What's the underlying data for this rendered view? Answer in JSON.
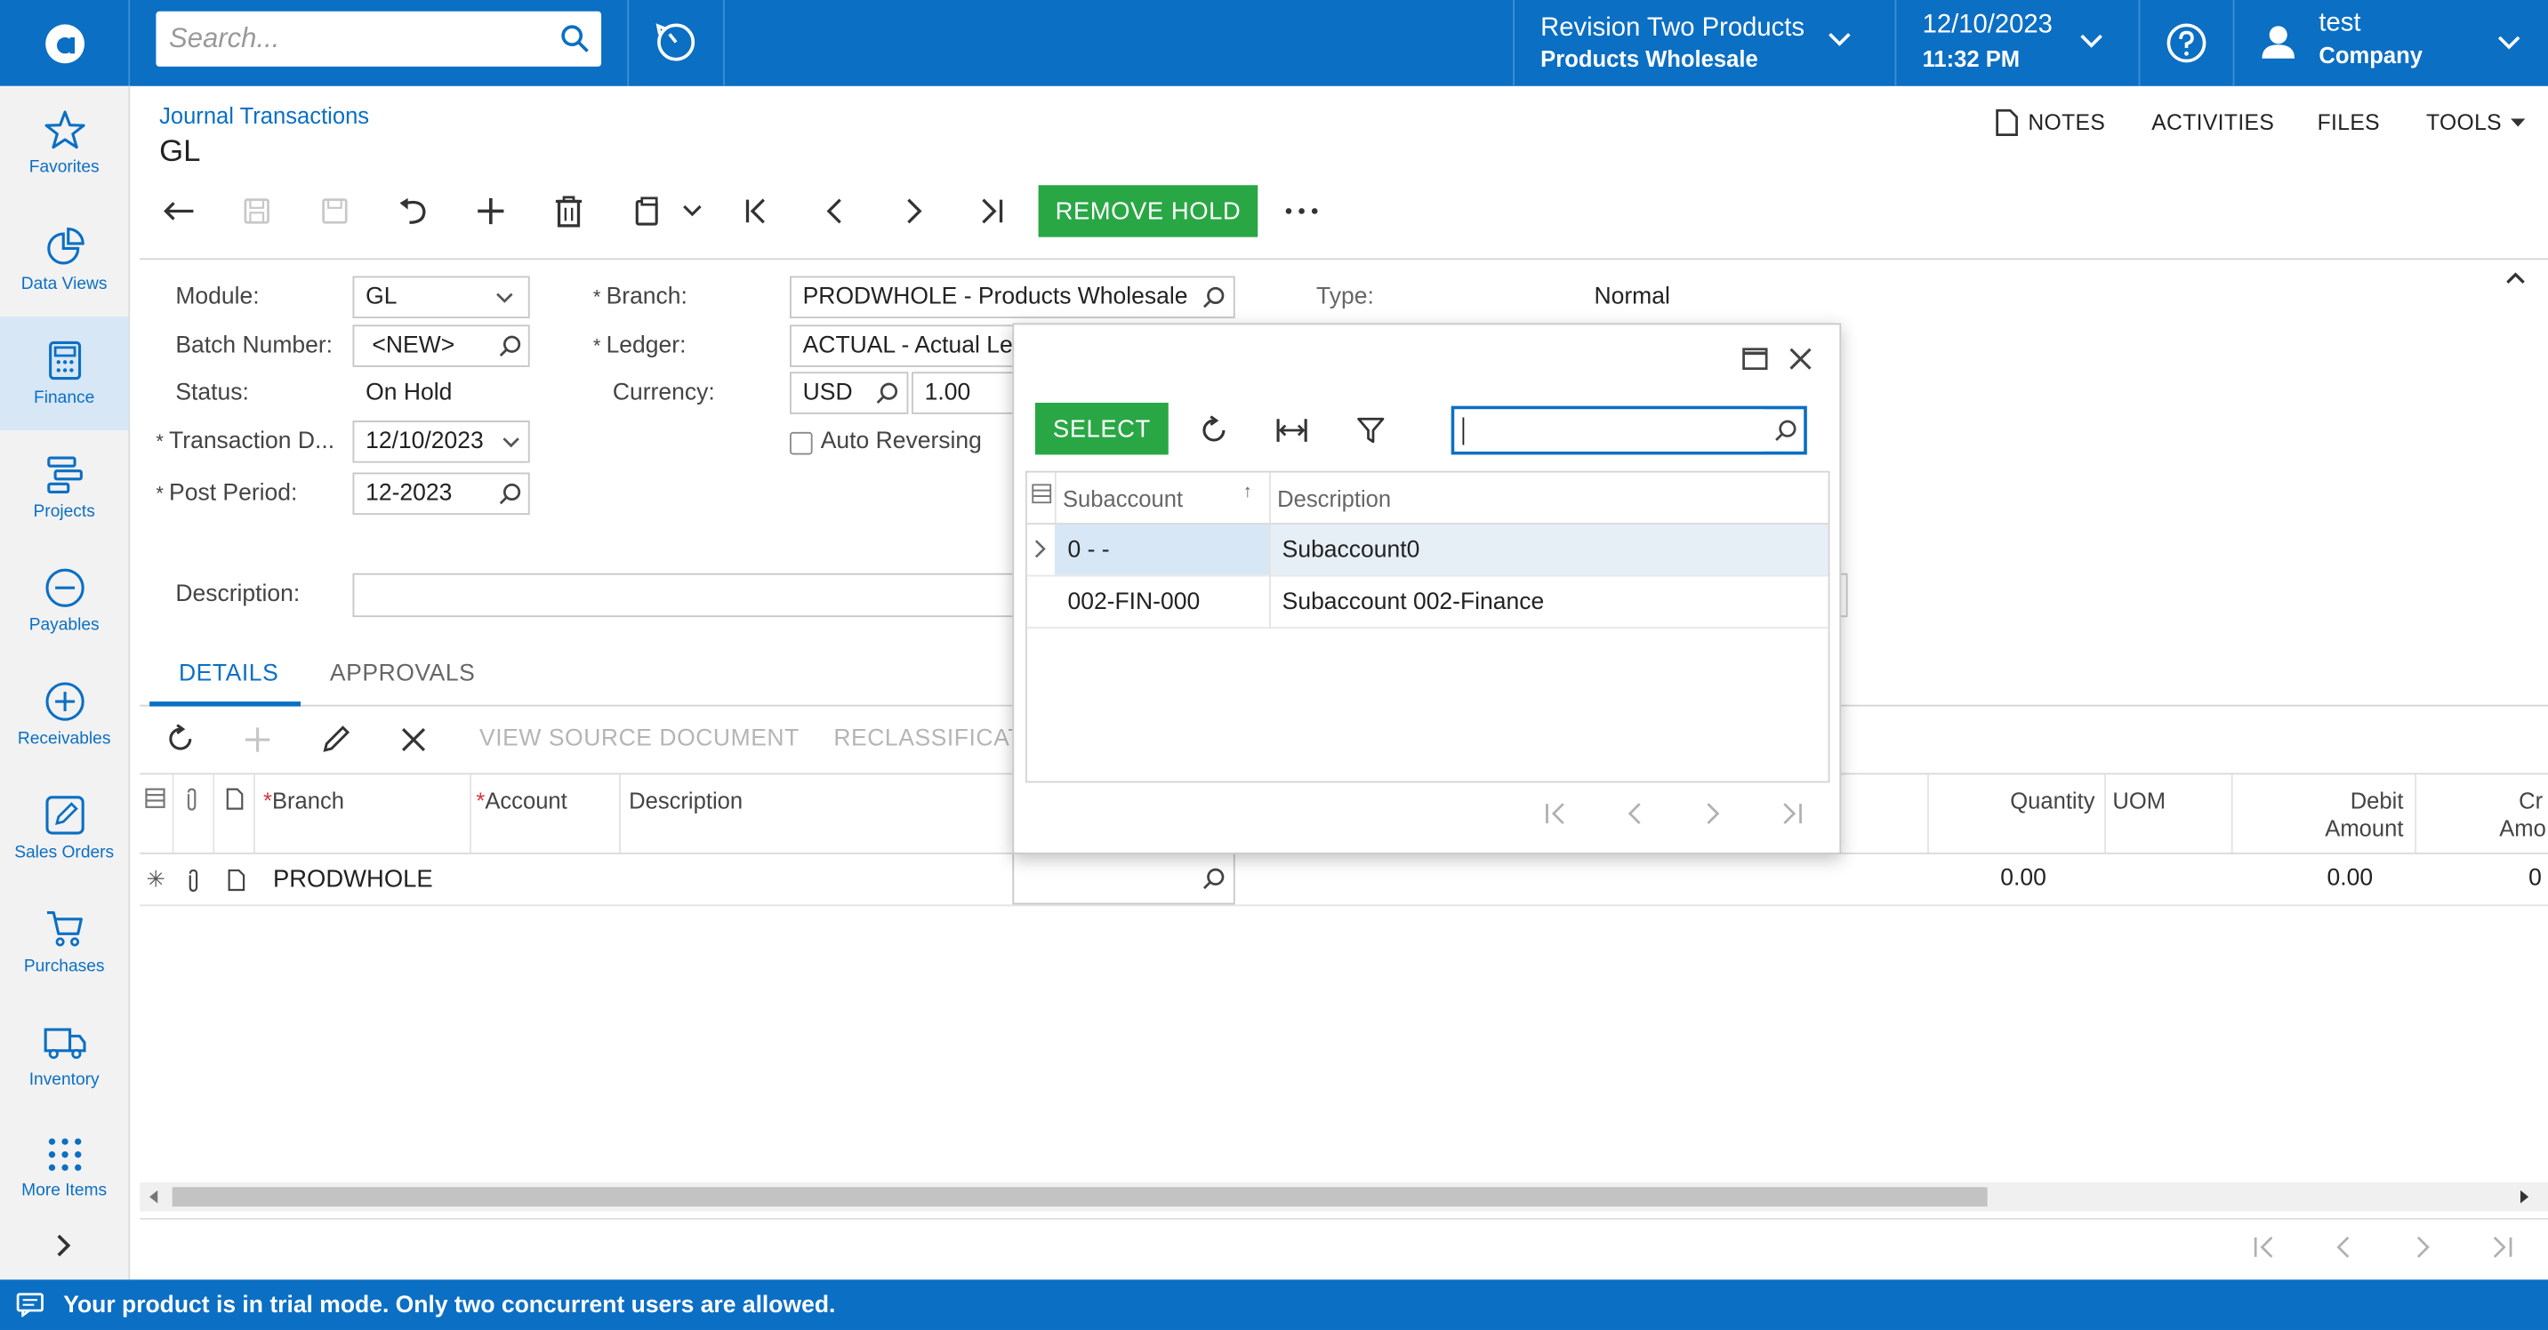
{
  "topbar": {
    "search_placeholder": "Search...",
    "tenant_name": "Revision Two Products",
    "tenant_branch": "Products Wholesale",
    "date": "12/10/2023",
    "time": "11:32 PM",
    "user_name": "test",
    "user_company": "Company"
  },
  "sidebar": {
    "items": [
      {
        "label": "Favorites",
        "icon": "star-icon"
      },
      {
        "label": "Data Views",
        "icon": "pie-chart-icon"
      },
      {
        "label": "Finance",
        "icon": "calculator-icon"
      },
      {
        "label": "Projects",
        "icon": "projects-icon"
      },
      {
        "label": "Payables",
        "icon": "minus-circle-icon"
      },
      {
        "label": "Receivables",
        "icon": "plus-circle-icon"
      },
      {
        "label": "Sales Orders",
        "icon": "pencil-square-icon"
      },
      {
        "label": "Purchases",
        "icon": "cart-icon"
      },
      {
        "label": "Inventory",
        "icon": "truck-icon"
      },
      {
        "label": "More Items",
        "icon": "grid-dots-icon"
      }
    ]
  },
  "header": {
    "breadcrumb": "Journal Transactions",
    "title": "GL",
    "links": {
      "notes": "NOTES",
      "activities": "ACTIVITIES",
      "files": "FILES",
      "tools": "TOOLS"
    },
    "remove_hold": "REMOVE HOLD"
  },
  "form": {
    "module_label": "Module:",
    "module_value": "GL",
    "batch_label": "Batch Number:",
    "batch_value": "<NEW>",
    "status_label": "Status:",
    "status_value": "On Hold",
    "trans_date_label": "Transaction D...",
    "trans_date_value": "12/10/2023",
    "post_period_label": "Post Period:",
    "post_period_value": "12-2023",
    "branch_label": "Branch:",
    "branch_value": "PRODWHOLE - Products Wholesale",
    "ledger_label": "Ledger:",
    "ledger_value": "ACTUAL - Actual Lec",
    "currency_label": "Currency:",
    "currency_value": "USD",
    "currency_rate": "1.00",
    "auto_reversing_label": "Auto Reversing",
    "type_label": "Type:",
    "type_value": "Normal",
    "description_label": "Description:"
  },
  "tabs": {
    "details": "DETAILS",
    "approvals": "APPROVALS"
  },
  "grid": {
    "actions": {
      "view_source": "VIEW SOURCE DOCUMENT",
      "reclassify": "RECLASSIFICAT"
    },
    "columns": {
      "branch": "Branch",
      "account": "Account",
      "description": "Description",
      "quantity": "Quantity",
      "uom": "UOM",
      "debit1": "Debit",
      "debit2": "Amount",
      "credit1": "Cr",
      "credit2": "Amo"
    },
    "row": {
      "branch": "PRODWHOLE",
      "quantity": "0.00",
      "debit": "0.00",
      "credit": "0"
    }
  },
  "popup": {
    "select_label": "SELECT",
    "columns": {
      "subaccount": "Subaccount",
      "description": "Description"
    },
    "rows": [
      {
        "subaccount": "0 - -",
        "description": "Subaccount0"
      },
      {
        "subaccount": "002-FIN-000",
        "description": "Subaccount 002-Finance"
      }
    ]
  },
  "trial_message": "Your product is in trial mode. Only two concurrent users are allowed.",
  "colors": {
    "brand_blue": "#0b6fc4",
    "action_green": "#2aa745",
    "selected_row": "#d7e7f6"
  }
}
